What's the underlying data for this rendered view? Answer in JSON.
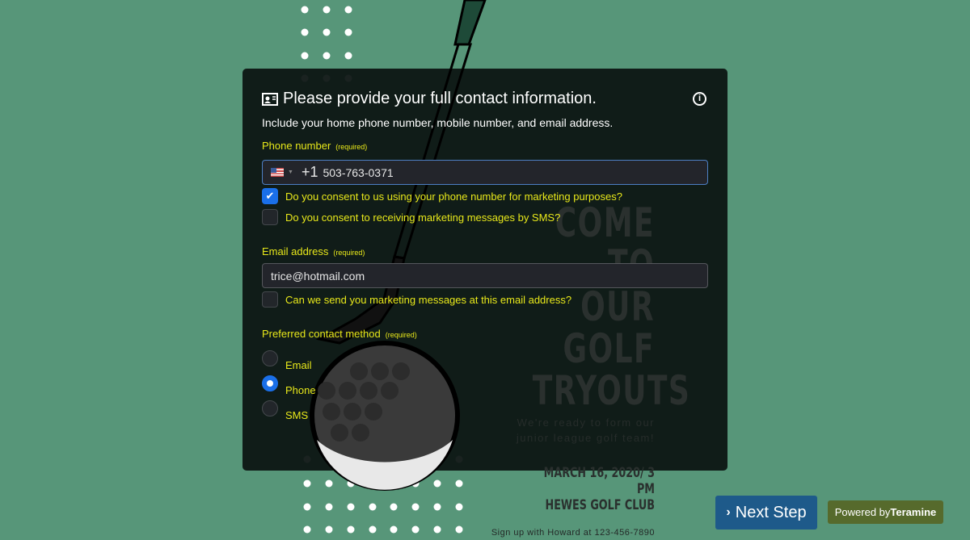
{
  "form": {
    "title": "Please provide your full contact information.",
    "description": "Include your home phone number, mobile number, and email address.",
    "phone": {
      "label": "Phone number",
      "required": "(required)",
      "country_code": "+1",
      "value": "503-763-0371",
      "consents": [
        {
          "label": "Do you consent to us using your phone number for marketing purposes?",
          "checked": true
        },
        {
          "label": "Do you consent to receiving marketing messages by SMS?",
          "checked": false
        }
      ]
    },
    "email": {
      "label": "Email address",
      "required": "(required)",
      "value": "trice@hotmail.com",
      "consents": [
        {
          "label": "Can we send you marketing messages at this email address?",
          "checked": false
        }
      ]
    },
    "contact_method": {
      "label": "Preferred contact method",
      "required": "(required)",
      "options": [
        "Email",
        "Phone",
        "SMS"
      ],
      "selected": "Phone"
    }
  },
  "poster": {
    "line1": "COME TO",
    "line2": "OUR GOLF",
    "line3": "TRYOUTS",
    "sub": "We're ready to form our junior league golf team!",
    "date": "MARCH 16, 2020/ 3 PM",
    "place": "HEWES GOLF CLUB",
    "signup": "Sign up with Howard at 123-456-7890"
  },
  "footer": {
    "next_label": "Next Step",
    "powered_prefix": "Powered by",
    "powered_brand": "Teramine"
  },
  "colors": {
    "background": "#579679",
    "label": "#e8e81a",
    "accent": "#1a6fe8",
    "next_button": "#1e5a8a",
    "powered_badge": "#566a2c"
  }
}
